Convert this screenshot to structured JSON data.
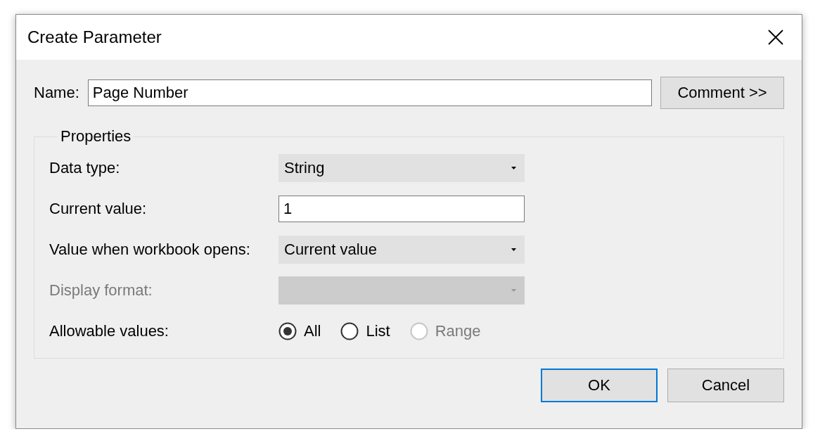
{
  "window": {
    "title": "Create Parameter"
  },
  "name_field": {
    "label": "Name:",
    "value": "Page Number"
  },
  "comment_button": "Comment >>",
  "properties": {
    "title": "Properties",
    "rows": [
      {
        "label": "Data type:",
        "kind": "dropdown",
        "value": "String",
        "disabled": false
      },
      {
        "label": "Current value:",
        "kind": "text",
        "value": "1",
        "disabled": false
      },
      {
        "label": "Value when workbook opens:",
        "kind": "dropdown",
        "value": "Current value",
        "disabled": false
      },
      {
        "label": "Display format:",
        "kind": "dropdown",
        "disabled": true
      },
      {
        "label": "Allowable values:",
        "kind": "radio",
        "disabled": false,
        "options": [
          {
            "label": "All",
            "selected": true,
            "disabled": false
          },
          {
            "label": "List",
            "selected": false,
            "disabled": false
          },
          {
            "label": "Range",
            "selected": false,
            "disabled": true
          }
        ]
      }
    ]
  },
  "buttons": [
    {
      "label": "OK",
      "default": true
    },
    {
      "label": "Cancel",
      "default": false
    }
  ]
}
